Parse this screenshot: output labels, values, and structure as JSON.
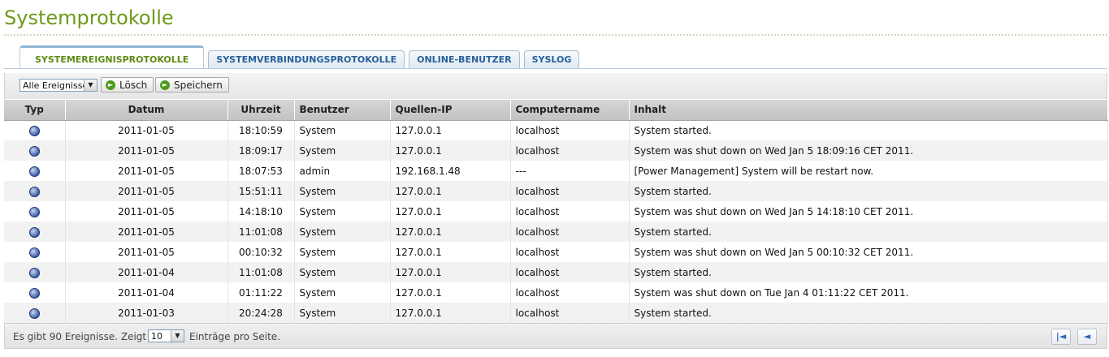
{
  "header": {
    "title": "Systemprotokolle"
  },
  "tabs": [
    {
      "label": "SYSTEMEREIGNISPROTOKOLLE",
      "active": true
    },
    {
      "label": "SYSTEMVERBINDUNGSPROTOKOLLE",
      "active": false
    },
    {
      "label": "ONLINE-BENUTZER",
      "active": false
    },
    {
      "label": "SYSLOG",
      "active": false
    }
  ],
  "toolbar": {
    "filter_value": "Alle Ereignisse",
    "delete_label": "Lösch",
    "save_label": "Speichern"
  },
  "table": {
    "columns": [
      "Typ",
      "Datum",
      "Uhrzeit",
      "Benutzer",
      "Quellen-IP",
      "Computername",
      "Inhalt"
    ],
    "rows": [
      {
        "type_icon": "info-icon",
        "date": "2011-01-05",
        "time": "18:10:59",
        "user": "System",
        "ip": "127.0.0.1",
        "computer": "localhost",
        "content": "System started."
      },
      {
        "type_icon": "info-icon",
        "date": "2011-01-05",
        "time": "18:09:17",
        "user": "System",
        "ip": "127.0.0.1",
        "computer": "localhost",
        "content": "System was shut down on Wed Jan 5 18:09:16 CET 2011."
      },
      {
        "type_icon": "info-icon",
        "date": "2011-01-05",
        "time": "18:07:53",
        "user": "admin",
        "ip": "192.168.1.48",
        "computer": "---",
        "content": "[Power Management] System will be restart now."
      },
      {
        "type_icon": "info-icon",
        "date": "2011-01-05",
        "time": "15:51:11",
        "user": "System",
        "ip": "127.0.0.1",
        "computer": "localhost",
        "content": "System started."
      },
      {
        "type_icon": "info-icon",
        "date": "2011-01-05",
        "time": "14:18:10",
        "user": "System",
        "ip": "127.0.0.1",
        "computer": "localhost",
        "content": "System was shut down on Wed Jan 5 14:18:10 CET 2011."
      },
      {
        "type_icon": "info-icon",
        "date": "2011-01-05",
        "time": "11:01:08",
        "user": "System",
        "ip": "127.0.0.1",
        "computer": "localhost",
        "content": "System started."
      },
      {
        "type_icon": "info-icon",
        "date": "2011-01-05",
        "time": "00:10:32",
        "user": "System",
        "ip": "127.0.0.1",
        "computer": "localhost",
        "content": "System was shut down on Wed Jan 5 00:10:32 CET 2011."
      },
      {
        "type_icon": "info-icon",
        "date": "2011-01-04",
        "time": "11:01:08",
        "user": "System",
        "ip": "127.0.0.1",
        "computer": "localhost",
        "content": "System started."
      },
      {
        "type_icon": "info-icon",
        "date": "2011-01-04",
        "time": "01:11:22",
        "user": "System",
        "ip": "127.0.0.1",
        "computer": "localhost",
        "content": "System was shut down on Tue Jan 4 01:11:22 CET 2011."
      },
      {
        "type_icon": "info-icon",
        "date": "2011-01-03",
        "time": "20:24:28",
        "user": "System",
        "ip": "127.0.0.1",
        "computer": "localhost",
        "content": "System started."
      }
    ]
  },
  "footer": {
    "text_before": "Es gibt 90 Ereignisse. Zeigt",
    "page_size": "10",
    "text_after": "Einträge pro Seite."
  },
  "colors": {
    "title": "#6e9a1a",
    "active_tab_text": "#5e8a17",
    "tab_text": "#27609a",
    "go_button": "#4f9b1d"
  },
  "icons": {
    "row_type": "info-icon",
    "first_page": "first-page-icon",
    "prev_page": "prev-page-icon"
  }
}
